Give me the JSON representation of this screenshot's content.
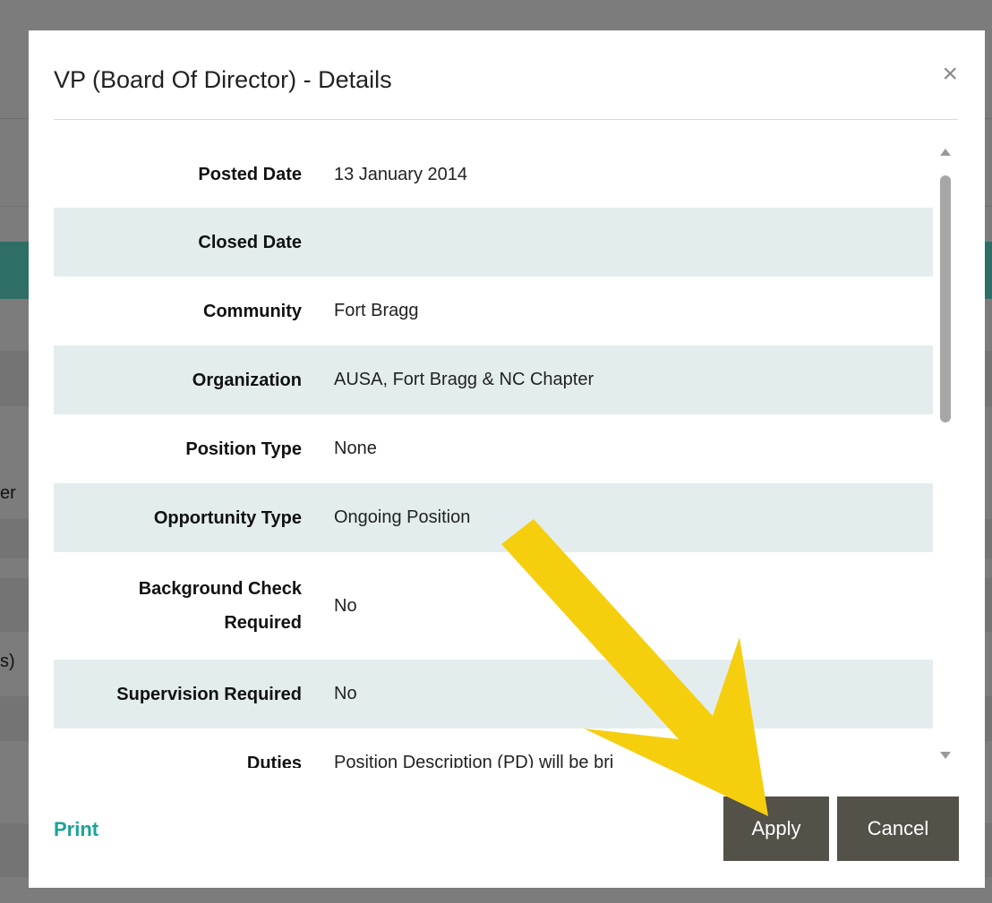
{
  "background": {
    "fragments": [
      "er",
      "s)"
    ],
    "accent_color": "#2f8a7d"
  },
  "modal": {
    "title": "VP (Board Of Director) - Details",
    "close_icon": "close-icon",
    "close_glyph": "×",
    "details": [
      {
        "label": "Posted Date",
        "value": "13 January 2014"
      },
      {
        "label": "Closed Date",
        "value": ""
      },
      {
        "label": "Community",
        "value": "Fort Bragg"
      },
      {
        "label": "Organization",
        "value": "AUSA, Fort Bragg & NC Chapter"
      },
      {
        "label": "Position Type",
        "value": "None"
      },
      {
        "label": "Opportunity Type",
        "value": "Ongoing Position"
      },
      {
        "label": "Background Check Required",
        "value": "No"
      },
      {
        "label": "Supervision Required",
        "value": "No"
      },
      {
        "label": "Duties",
        "value": "Position Description (PD) will be bri"
      }
    ],
    "footer": {
      "print_label": "Print",
      "apply_label": "Apply",
      "cancel_label": "Cancel"
    }
  },
  "annotation": {
    "icon": "arrow-pointer-icon",
    "color": "#f5cf0e"
  }
}
